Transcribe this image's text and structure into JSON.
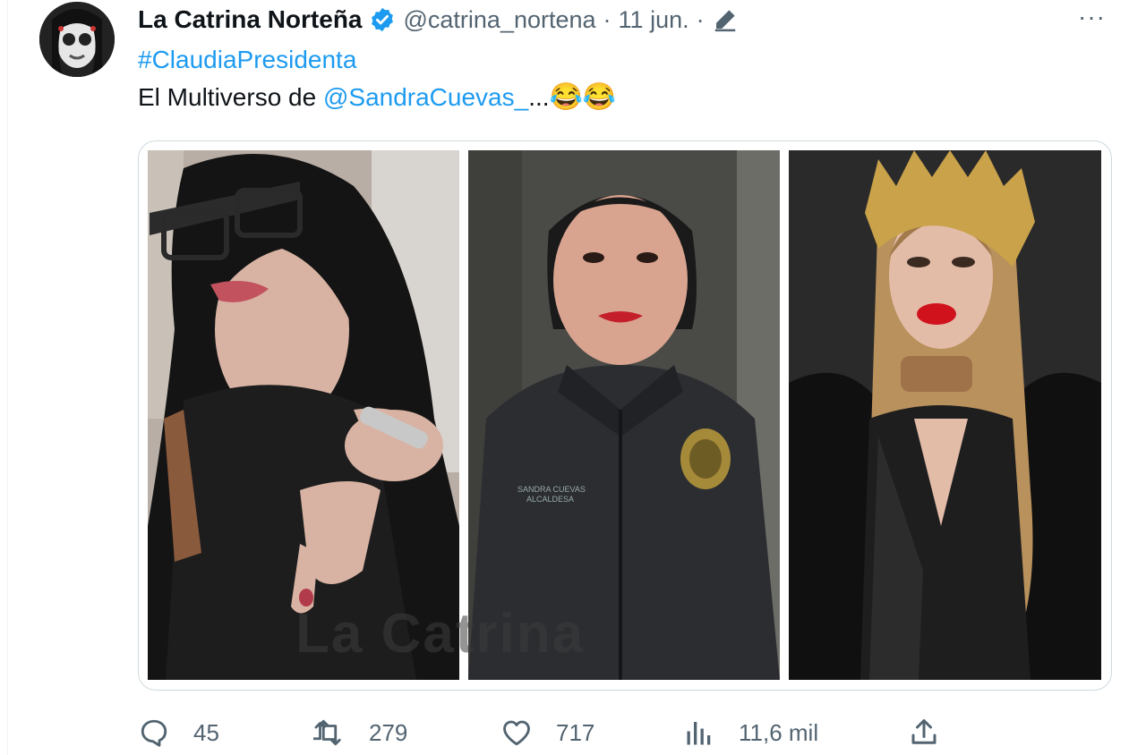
{
  "tweet": {
    "author_name": "La Catrina Norteña",
    "handle": "@catrina_nortena",
    "separator": "·",
    "date": "11 jun.",
    "separator2": "·",
    "more": "···",
    "hashtag": "#ClaudiaPresidenta",
    "body_prefix": "El Multiverso de ",
    "body_mention": "@SandraCuevas_",
    "body_suffix": "...",
    "body_emoji": "😂😂",
    "watermark": "La Catrina",
    "badge_text_1": "SANDRA CUEVAS",
    "badge_text_2": "ALCALDESA"
  },
  "actions": {
    "replies": "45",
    "retweets": "279",
    "likes": "717",
    "views": "11,6 mil"
  },
  "icons": {
    "verified": "verified-badge-icon",
    "edit": "edited-pencil-icon",
    "reply": "reply-icon",
    "retweet": "retweet-icon",
    "like": "heart-icon",
    "views": "views-icon",
    "share": "share-icon"
  },
  "colors": {
    "accent": "#1d9bf0",
    "secondary_text": "#536471",
    "border": "#cfd9de"
  }
}
